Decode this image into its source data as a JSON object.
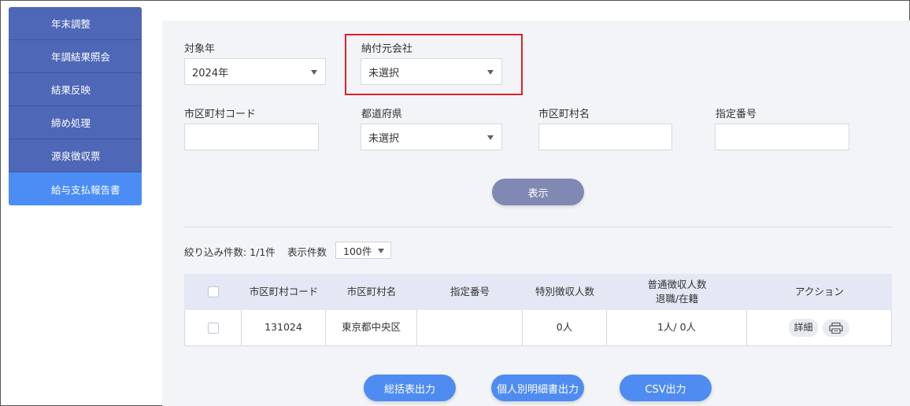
{
  "sidebar": {
    "items": [
      {
        "label": "年末調整"
      },
      {
        "label": "年調結果照会"
      },
      {
        "label": "結果反映"
      },
      {
        "label": "締め処理"
      },
      {
        "label": "源泉徴収票"
      },
      {
        "label": "給与支払報告書"
      }
    ]
  },
  "filters": {
    "target_year": {
      "label": "対象年",
      "value": "2024年"
    },
    "payer_company": {
      "label": "納付元会社",
      "value": "未選択"
    },
    "municipality_code": {
      "label": "市区町村コード",
      "value": ""
    },
    "prefecture": {
      "label": "都道府県",
      "value": "未選択"
    },
    "municipality_name": {
      "label": "市区町村名",
      "value": ""
    },
    "designated_number": {
      "label": "指定番号",
      "value": ""
    },
    "show_button": "表示"
  },
  "results": {
    "count_label": "絞り込み件数: 1/1件",
    "per_page_label": "表示件数",
    "per_page_value": "100件"
  },
  "table": {
    "headers": {
      "code": "市区町村コード",
      "name": "市区町村名",
      "designated": "指定番号",
      "special": "特別徴収人数",
      "ordinary_line1": "普通徴収人数",
      "ordinary_line2": "退職/在籍",
      "action": "アクション"
    },
    "rows": [
      {
        "code": "131024",
        "name": "東京都中央区",
        "designated": "",
        "special": "0人",
        "ordinary": "1人/ 0人",
        "detail": "詳細"
      }
    ]
  },
  "actions": {
    "summary_output": "総括表出力",
    "individual_output": "個人別明細書出力",
    "csv_output": "CSV出力"
  },
  "icons": {
    "print": "printer-icon"
  },
  "colors": {
    "sidebar": "#4e67b6",
    "sidebar_active": "#4b8df5",
    "primary_button": "#4f8cf2",
    "show_button": "#8088b3",
    "highlight": "#e0202a"
  }
}
